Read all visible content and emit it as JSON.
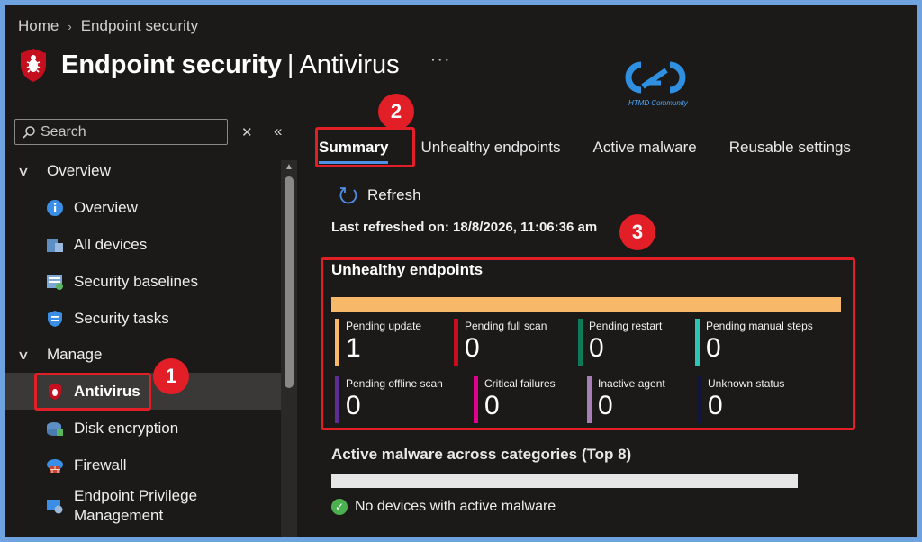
{
  "breadcrumb": {
    "home": "Home",
    "sep": "›",
    "current": "Endpoint security"
  },
  "header": {
    "title": "Endpoint security",
    "separator": "|",
    "subtitle": "Antivirus",
    "more": "···"
  },
  "logo": {
    "caption": "HTMD Community"
  },
  "search": {
    "placeholder": "Search",
    "close": "✕",
    "collapse": "«"
  },
  "sidebar": {
    "groups": [
      {
        "label": "Overview",
        "items": [
          "Overview",
          "All devices",
          "Security baselines",
          "Security tasks"
        ]
      },
      {
        "label": "Manage",
        "items": [
          "Antivirus",
          "Disk encryption",
          "Firewall",
          "Endpoint Privilege",
          "Management"
        ]
      }
    ]
  },
  "tabs": [
    "Summary",
    "Unhealthy endpoints",
    "Active malware",
    "Reusable settings"
  ],
  "refresh_label": "Refresh",
  "last_refreshed": "Last refreshed on: 18/8/2026, 11:06:36 am",
  "unhealthy": {
    "title": "Unhealthy endpoints",
    "tiles": [
      {
        "label": "Pending update",
        "value": "1",
        "color": "#f7b86a"
      },
      {
        "label": "Pending full scan",
        "value": "0",
        "color": "#c50f1f"
      },
      {
        "label": "Pending restart",
        "value": "0",
        "color": "#0e7a5a"
      },
      {
        "label": "Pending manual steps",
        "value": "0",
        "color": "#2ec4b6"
      },
      {
        "label": "Pending offline scan",
        "value": "0",
        "color": "#5c2e91"
      },
      {
        "label": "Critical failures",
        "value": "0",
        "color": "#e3008c"
      },
      {
        "label": "Inactive agent",
        "value": "0",
        "color": "#a67fb8"
      },
      {
        "label": "Unknown status",
        "value": "0",
        "color": "#0f1640"
      }
    ]
  },
  "malware": {
    "title": "Active malware across categories (Top 8)",
    "status": "No devices with active malware"
  },
  "callouts": [
    "1",
    "2",
    "3"
  ]
}
